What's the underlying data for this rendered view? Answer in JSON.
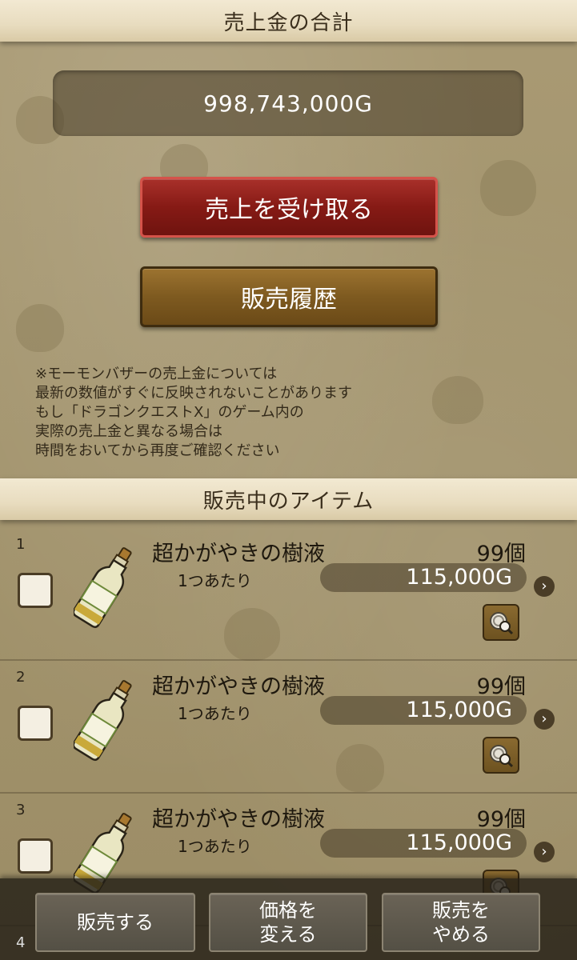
{
  "sales_total": {
    "header": "売上金の合計",
    "amount": "998,743,000G",
    "receive_button": "売上を受け取る",
    "history_button": "販売履歴"
  },
  "notice_lines": [
    "※モーモンバザーの売上金については",
    "最新の数値がすぐに反映されないことがあります",
    "もし「ドラゴンクエストX」のゲーム内の",
    "実際の売上金と異なる場合は",
    "時間をおいてから再度ご確認ください"
  ],
  "items_section": {
    "header": "販売中のアイテム",
    "per_unit_label": "1つあたり",
    "items": [
      {
        "number": "1",
        "name": "超かがやきの樹液",
        "quantity": "99個",
        "price": "115,000G"
      },
      {
        "number": "2",
        "name": "超かがやきの樹液",
        "quantity": "99個",
        "price": "115,000G"
      },
      {
        "number": "3",
        "name": "超かがやきの樹液",
        "quantity": "99個",
        "price": "115,000G"
      }
    ],
    "next_row_number": "4"
  },
  "bottom_bar": {
    "sell_button": "販売する",
    "change_price_line1": "価格を",
    "change_price_line2": "変える",
    "stop_selling_line1": "販売を",
    "stop_selling_line2": "やめる"
  },
  "colors": {
    "receive_button": "#861a15",
    "history_button": "#7e5a20",
    "header_bar": "#ece2c8"
  },
  "icons": {
    "row_arrow": "chevron-right-icon",
    "price_search": "coin-search-icon",
    "item": "bottle-icon"
  }
}
